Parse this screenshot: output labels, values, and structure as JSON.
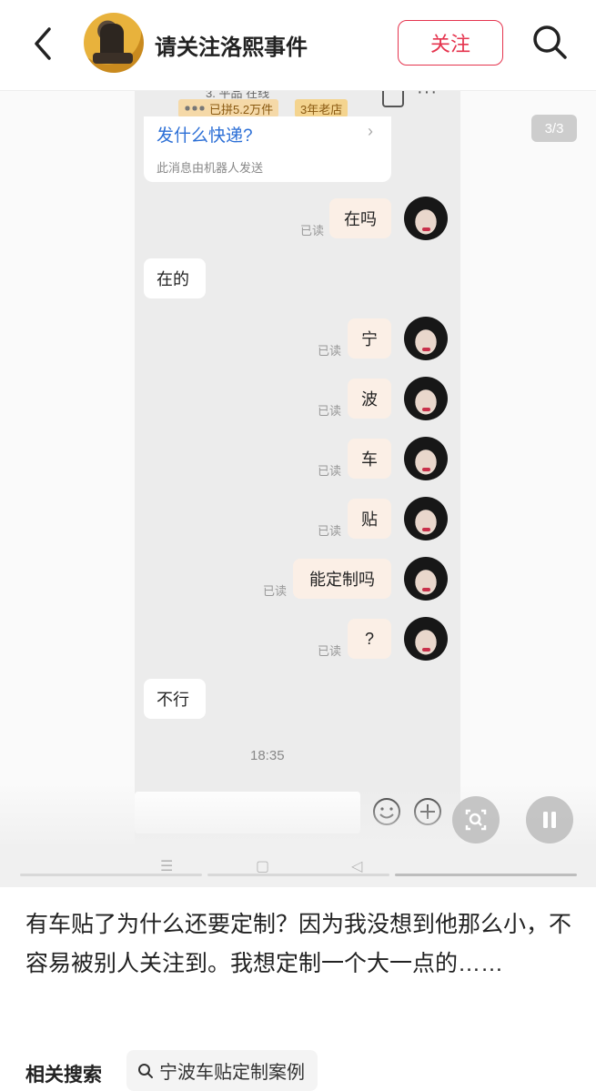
{
  "header": {
    "author_name": "请关注洛熙事件",
    "follow_label": "关注"
  },
  "shop_strip": {
    "partial_text": "3. 平品   在线",
    "sales_badge": "已拼5.2万件",
    "age_badge": "3年老店"
  },
  "page_indicator": "3/3",
  "bot_card": {
    "question": "发什么快递?",
    "chevron": "›",
    "note": "此消息由机器人发送"
  },
  "chat": {
    "read_label": "已读",
    "messages": [
      {
        "side": "right",
        "text": "在吗"
      },
      {
        "side": "left",
        "text": "在的"
      },
      {
        "side": "right",
        "text": "宁"
      },
      {
        "side": "right",
        "text": "波"
      },
      {
        "side": "right",
        "text": "车"
      },
      {
        "side": "right",
        "text": "贴"
      },
      {
        "side": "right",
        "text": "能定制吗"
      },
      {
        "side": "right",
        "text": "?"
      },
      {
        "side": "left",
        "text": "不行"
      }
    ],
    "timestamp": "18:35"
  },
  "caption": "有车贴了为什么还要定制？因为我没想到他那么小，不容易被别人关注到。我想定制一个大一点的……",
  "related": {
    "label": "相关搜索",
    "query": "宁波车贴定制案例"
  },
  "nav_glyphs": [
    "☰",
    "▢",
    "◁"
  ],
  "colors": {
    "accent": "#e5344e",
    "bot_link": "#2c6fd6",
    "bubble_out": "#fbefe6",
    "chat_bg": "#ececec"
  }
}
